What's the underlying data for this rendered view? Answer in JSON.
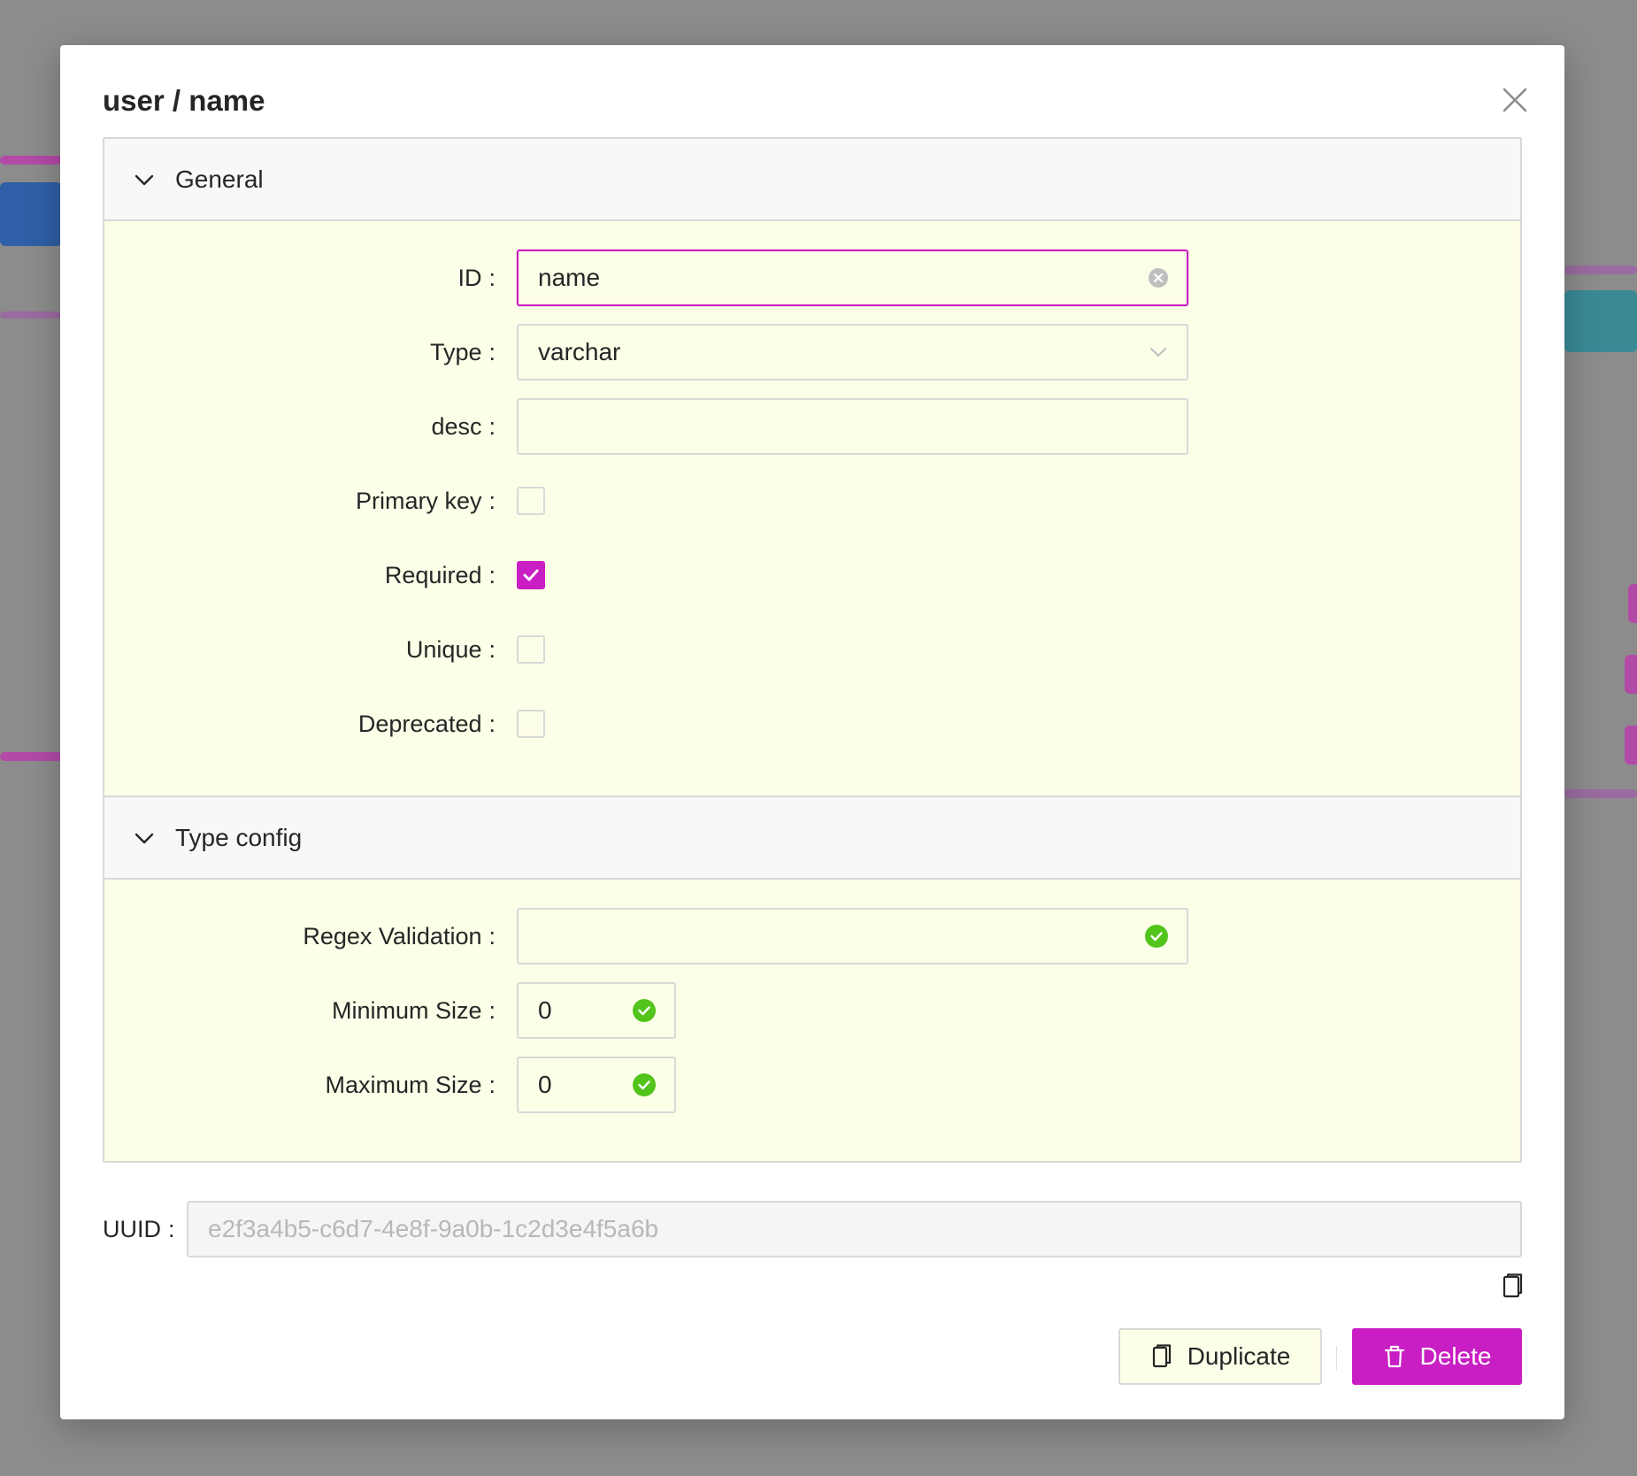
{
  "modal": {
    "title": "user / name",
    "colors": {
      "accent": "#c91ec4",
      "success": "#52c41a",
      "panel_bg": "#fcfee8"
    }
  },
  "general": {
    "title": "General",
    "fields": {
      "id": {
        "label": "ID",
        "value": "name"
      },
      "type": {
        "label": "Type",
        "value": "varchar"
      },
      "desc": {
        "label": "desc",
        "value": ""
      },
      "primary_key": {
        "label": "Primary key",
        "checked": false
      },
      "required": {
        "label": "Required",
        "checked": true
      },
      "unique": {
        "label": "Unique",
        "checked": false
      },
      "deprecated": {
        "label": "Deprecated",
        "checked": false
      }
    }
  },
  "type_config": {
    "title": "Type config",
    "fields": {
      "regex": {
        "label": "Regex Validation",
        "value": ""
      },
      "min_size": {
        "label": "Minimum Size",
        "value": "0"
      },
      "max_size": {
        "label": "Maximum Size",
        "value": "0"
      }
    }
  },
  "uuid": {
    "label": "UUID",
    "value": "e2f3a4b5-c6d7-4e8f-9a0b-1c2d3e4f5a6b"
  },
  "actions": {
    "duplicate_label": "Duplicate",
    "delete_label": "Delete"
  },
  "colon": ":"
}
